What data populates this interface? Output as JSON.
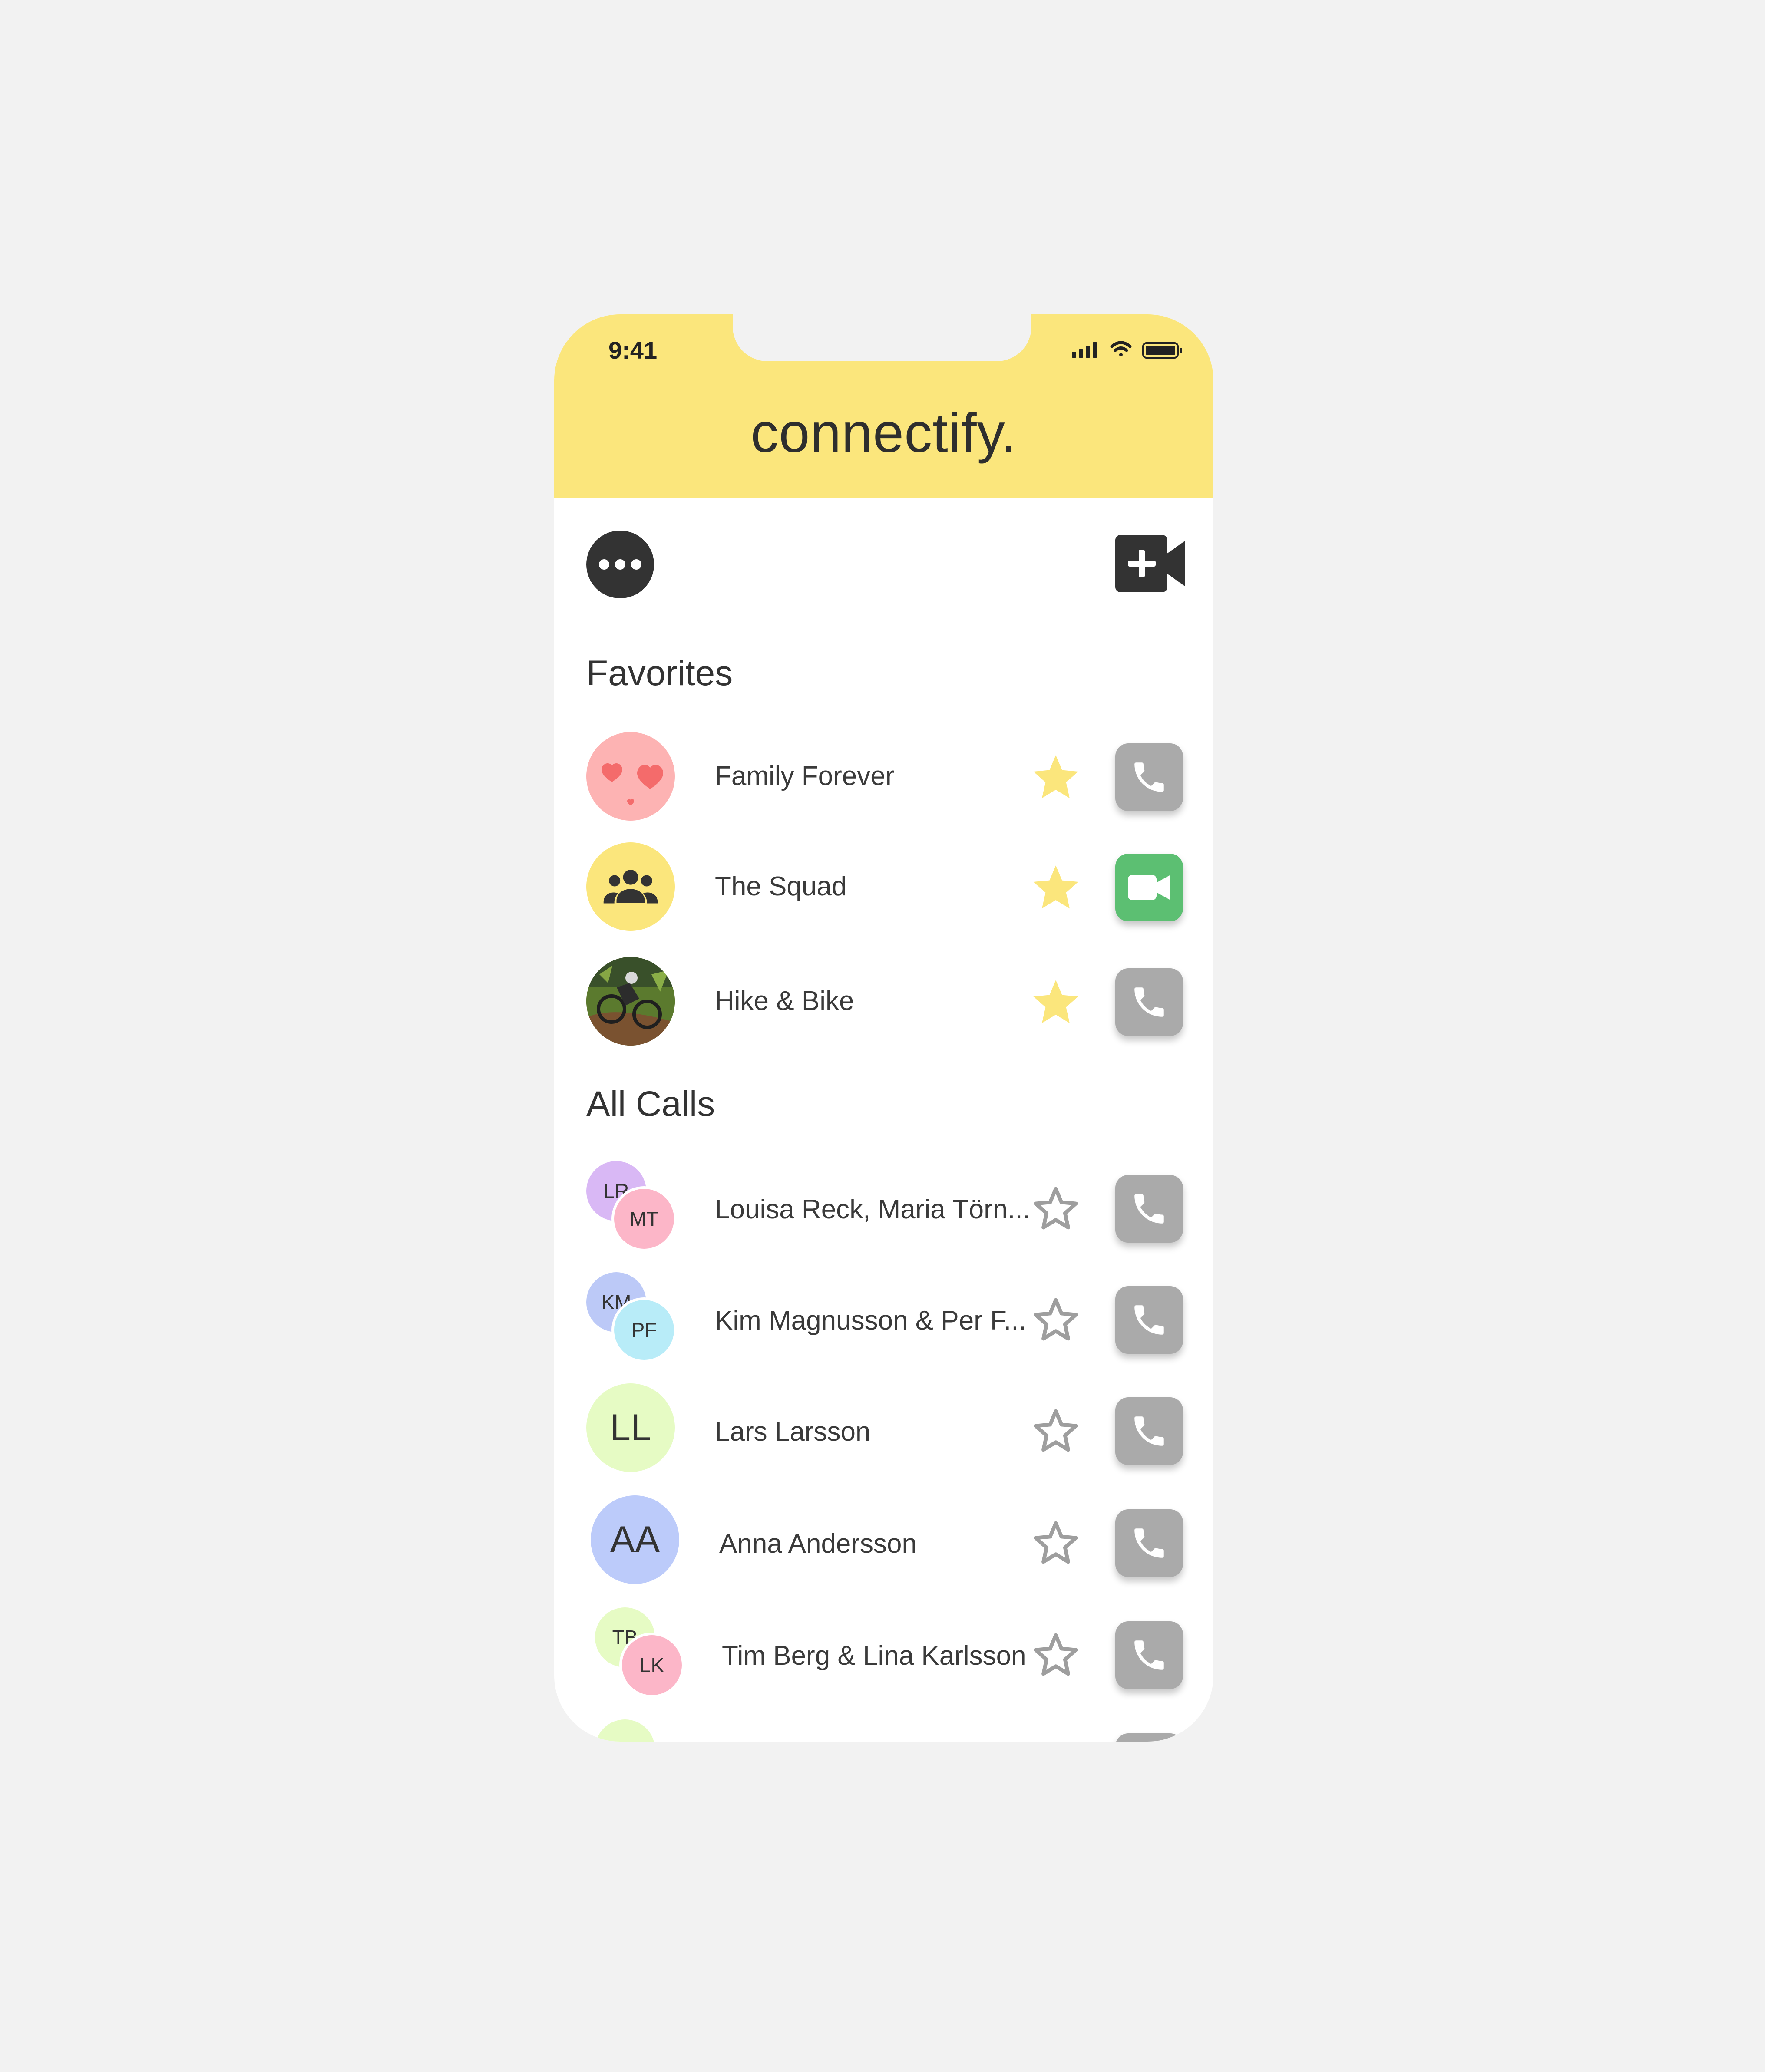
{
  "status_bar": {
    "time": "9:41"
  },
  "app": {
    "logo": "connectify."
  },
  "toolbar": {
    "menu_icon": "more-icon",
    "new_call_icon": "video-add-icon"
  },
  "colors": {
    "header": "#fbe67c",
    "star_active": "#fbe67c",
    "star_inactive": "#9e9e9e",
    "call_button": "#aaaaaa",
    "video_button": "#5cbf72"
  },
  "favorites": {
    "title": "Favorites",
    "items": [
      {
        "name": "Family Forever",
        "avatar": "hearts-icon",
        "favorite": true,
        "action": "phone-icon"
      },
      {
        "name": "The Squad",
        "avatar": "group-icon",
        "favorite": true,
        "action": "video-icon"
      },
      {
        "name": "Hike & Bike",
        "avatar": "photo",
        "favorite": true,
        "action": "phone-icon"
      }
    ]
  },
  "all_calls": {
    "title": "All Calls",
    "items": [
      {
        "name": "Louisa Reck, Maria Törn...",
        "initials": [
          "LR",
          "MT"
        ],
        "favorite": false,
        "action": "phone-icon"
      },
      {
        "name": "Kim Magnusson & Per F...",
        "initials": [
          "KM",
          "PF"
        ],
        "favorite": false,
        "action": "phone-icon"
      },
      {
        "name": "Lars Larsson",
        "initials": [
          "LL"
        ],
        "favorite": false,
        "action": "phone-icon"
      },
      {
        "name": "Anna Andersson",
        "initials": [
          "AA"
        ],
        "favorite": false,
        "action": "phone-icon"
      },
      {
        "name": "Tim Berg & Lina Karlsson",
        "initials": [
          "TB",
          "LK"
        ],
        "favorite": false,
        "action": "phone-icon"
      }
    ]
  }
}
